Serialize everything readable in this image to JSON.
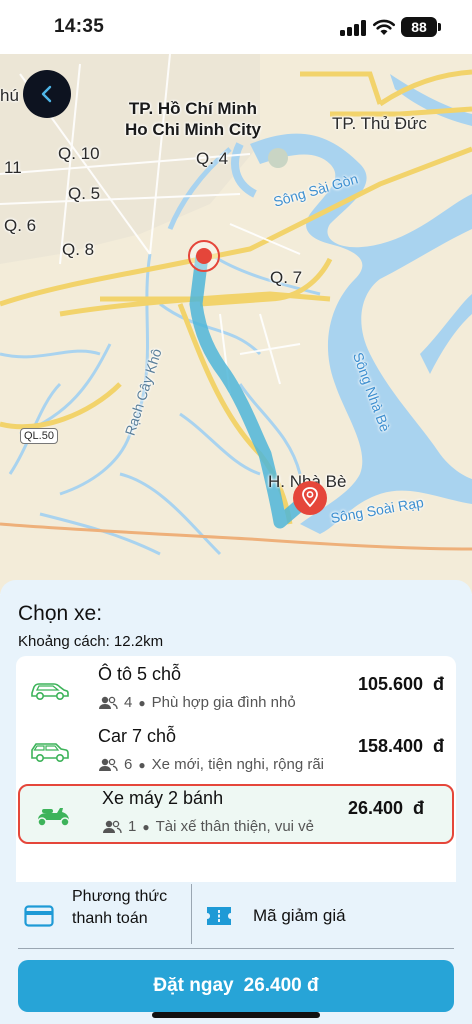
{
  "status_bar": {
    "time": "14:35",
    "battery": "88"
  },
  "map": {
    "labels": {
      "city_vi": "TP. Hồ Chí Minh",
      "city_en": "Ho Chi Minh City",
      "thu_duc": "TP. Thủ Đức",
      "q10": "Q. 10",
      "q4": "Q. 4",
      "q11": "11",
      "q5": "Q. 5",
      "q6": "Q. 6",
      "q8": "Q. 8",
      "q7": "Q. 7",
      "phu": "hú",
      "song_sai_gon": "Sông Sài Gòn",
      "rach_cay_kho": "Rạch Cây Khô",
      "song_nha_be": "Sông Nhà Bè",
      "ql50": "QL.50",
      "nha_be": "H. Nhà Bè",
      "song_soai_rap": "Sông Soài Rạp"
    }
  },
  "sheet": {
    "title": "Chọn xe:",
    "distance": "Khoảng cách: 12.2km",
    "vehicles": [
      {
        "name": "Ô tô 5 chỗ",
        "seats": "4",
        "desc": "Phù hợp gia đình nhỏ",
        "price": "105.600  đ",
        "icon": "car-outline-icon",
        "selected": false
      },
      {
        "name": "Car 7 chỗ",
        "seats": "6",
        "desc": "Xe mới, tiện nghi, rộng rãi",
        "price": "158.400  đ",
        "icon": "suv-outline-icon",
        "selected": false
      },
      {
        "name": "Xe máy 2 bánh",
        "seats": "1",
        "desc": "Tài xế thân thiện, vui vẻ",
        "price": "26.400  đ",
        "icon": "scooter-icon",
        "selected": true
      }
    ],
    "payment_label": "Phương thức thanh toán",
    "promo_label": "Mã giảm giá",
    "book_label": "Đặt ngay",
    "book_price": "26.400 đ"
  },
  "colors": {
    "accent": "#27a4d7",
    "selected_border": "#e5463a",
    "route": "#4fb6d8",
    "vehicle_green": "#3db35a",
    "water": "#a9d3ef"
  }
}
